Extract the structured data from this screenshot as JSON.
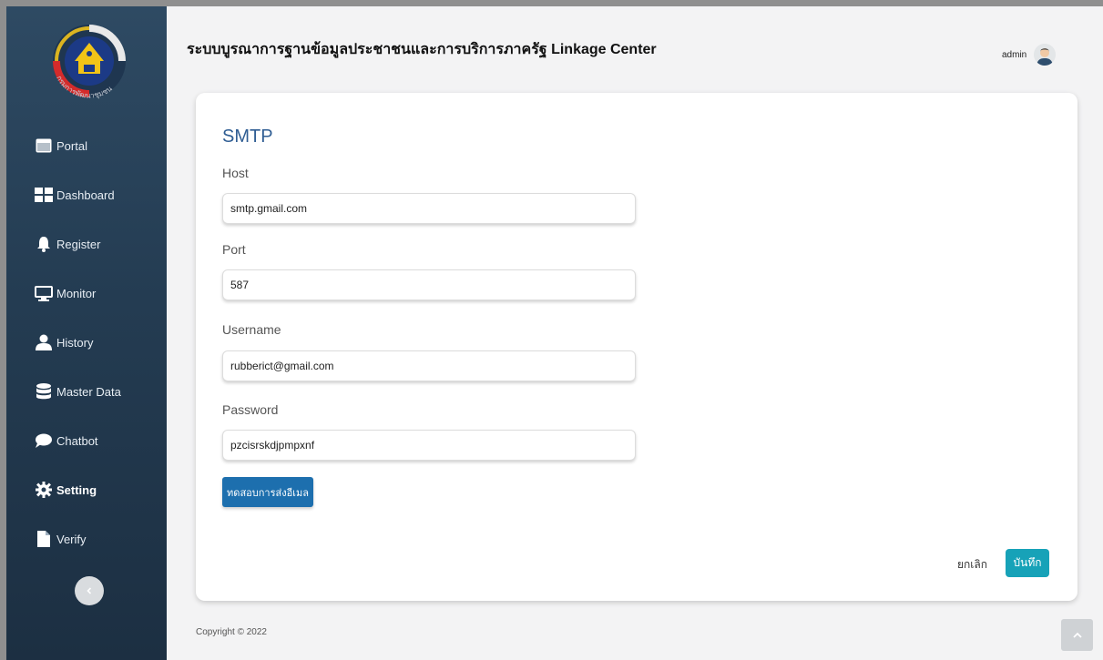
{
  "app": {
    "title": "ระบบบูรณาการฐานข้อมูลประชาชนและการบริการภาครัฐ Linkage Center"
  },
  "user": {
    "name": "admin"
  },
  "logo": {
    "text": "กรมการพัฒนาชุมชน"
  },
  "sidebar": {
    "items": [
      {
        "label": "Portal",
        "icon": "portal-icon"
      },
      {
        "label": "Dashboard",
        "icon": "dashboard-icon"
      },
      {
        "label": "Register",
        "icon": "bell-icon"
      },
      {
        "label": "Monitor",
        "icon": "monitor-icon"
      },
      {
        "label": "History",
        "icon": "user-icon"
      },
      {
        "label": "Master Data",
        "icon": "database-icon"
      },
      {
        "label": "Chatbot",
        "icon": "chat-icon"
      },
      {
        "label": "Setting",
        "icon": "gear-icon",
        "active": true
      },
      {
        "label": "Verify",
        "icon": "file-icon"
      }
    ]
  },
  "form": {
    "title": "SMTP",
    "host": {
      "label": "Host",
      "value": "smtp.gmail.com"
    },
    "port": {
      "label": "Port",
      "value": "587"
    },
    "username": {
      "label": "Username",
      "value": "rubberict@gmail.com"
    },
    "password": {
      "label": "Password",
      "value": "pzcisrskdjpmpxnf"
    },
    "test_button": "ทดสอบการส่งอีเมล",
    "cancel_button": "ยกเลิก",
    "save_button": "บันทึก"
  },
  "footer": {
    "copyright": "Copyright © 2022"
  },
  "colors": {
    "sidebar": "#2e4a63",
    "accent_title": "#2f5d93",
    "primary_button": "#1d6fae",
    "save_button": "#17a2b8"
  }
}
